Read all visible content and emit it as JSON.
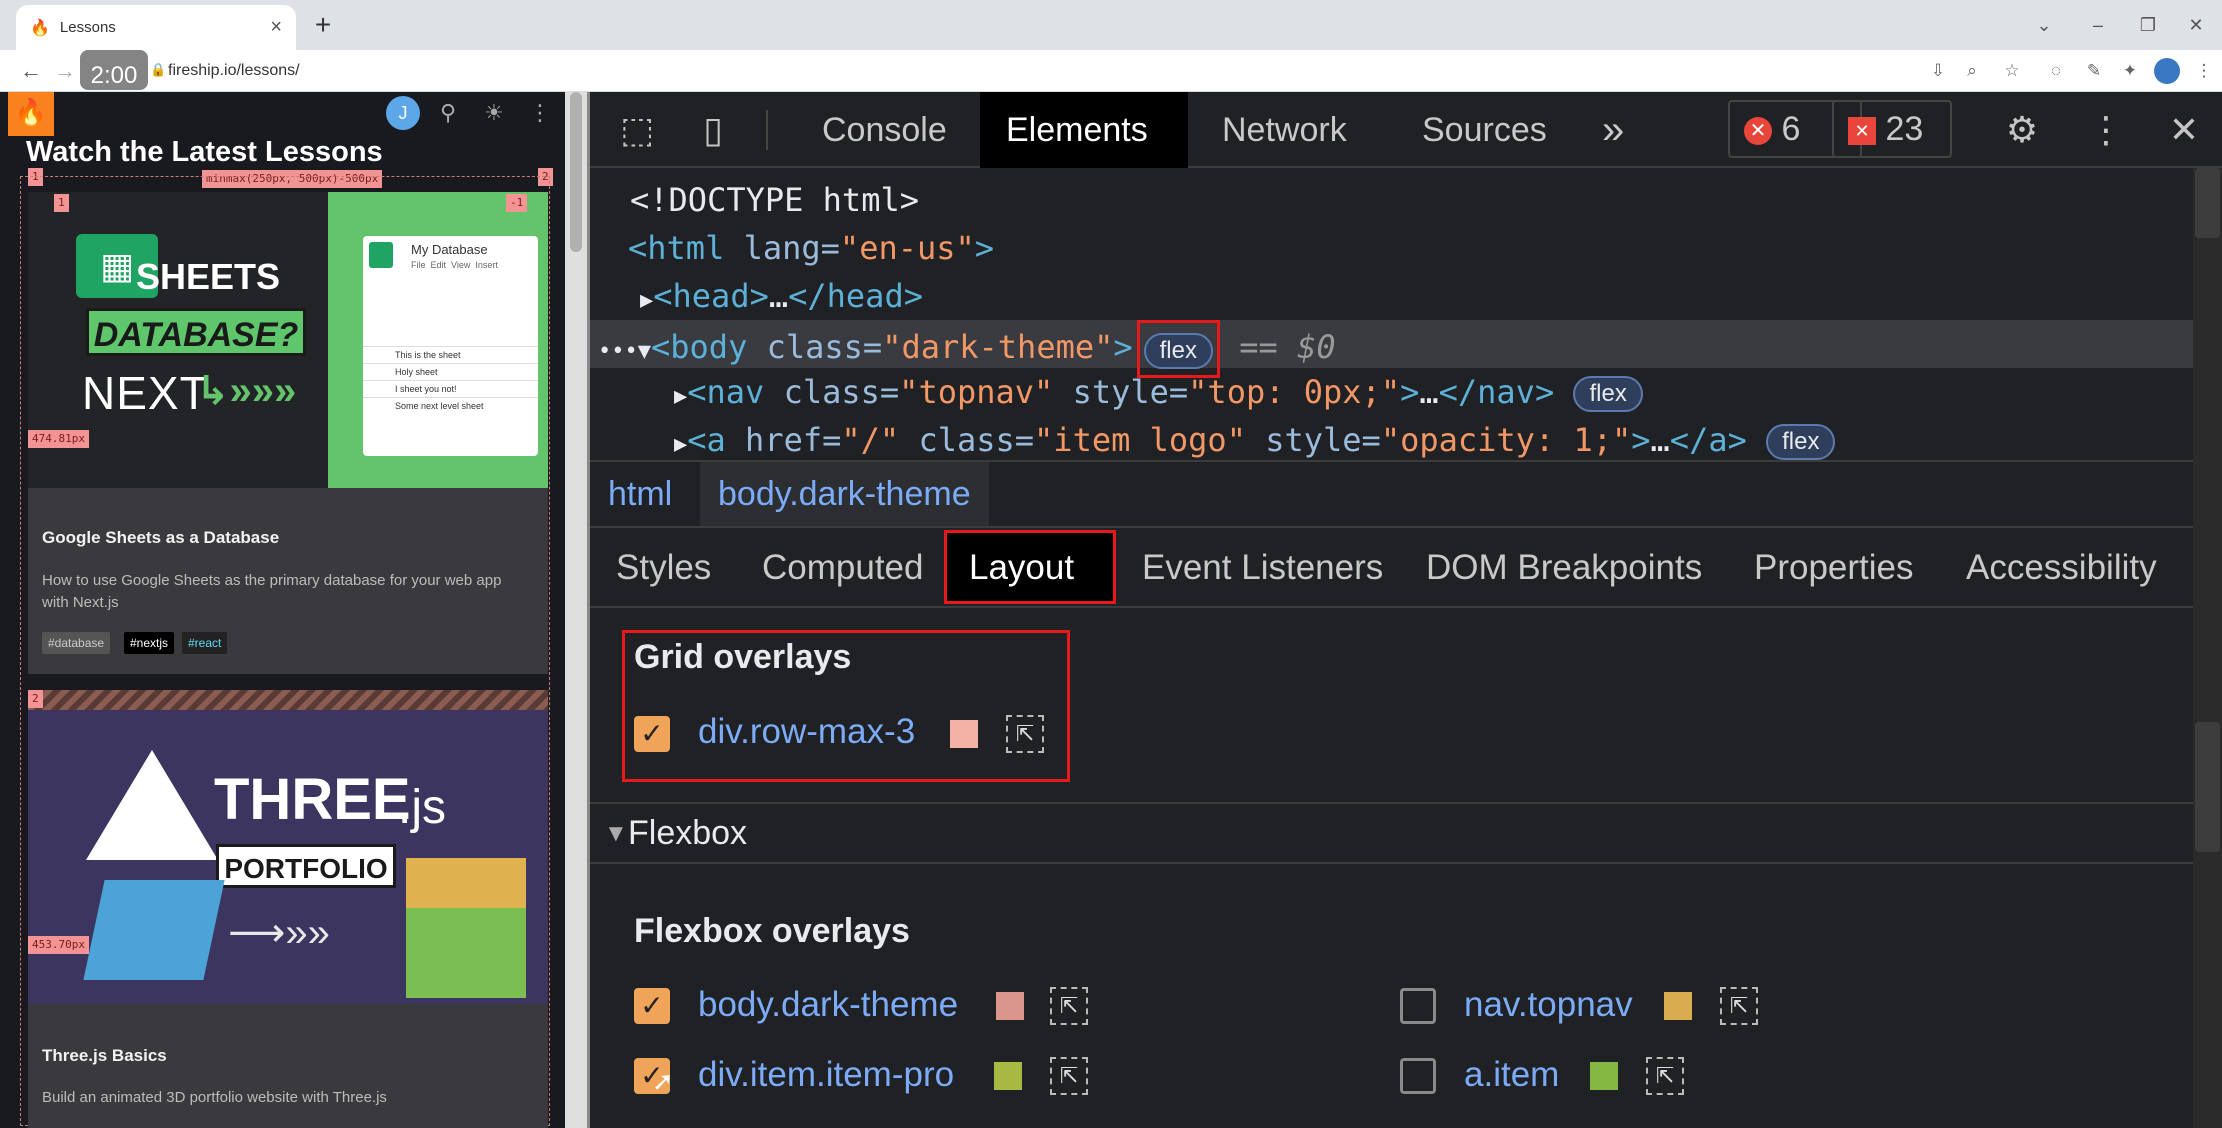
{
  "browser": {
    "tab_title": "Lessons",
    "tab_close": "×",
    "new_tab": "+",
    "url": "fireship.io/lessons/",
    "timer": "2:00",
    "window_controls": [
      "minimize-icon",
      "restore-icon",
      "close-icon"
    ]
  },
  "page": {
    "logo_text": "🔥",
    "avatar_text": "J",
    "heading": "Watch the Latest Lessons",
    "grid_badges": [
      "1",
      "minmax(250px, 500px)-500px",
      "2",
      "1",
      "-1",
      "474.81px",
      "2",
      "453.70px"
    ],
    "cards": [
      {
        "image_title_1": "SHEETS",
        "image_title_2": "DATABASE?",
        "image_title_3": "NEXT",
        "mini_sheet_title": "My Database",
        "mini_sheet_rows": [
          "This is the sheet",
          "Holy sheet",
          "I sheet you not!",
          "Some next level sheet"
        ],
        "mini_sheet_menu": "File  Edit  View  Insert",
        "title": "Google Sheets as a Database",
        "desc": "How to use Google Sheets as the primary database for your web app with Next.js",
        "tags": [
          "#database",
          "#nextjs",
          "#react"
        ]
      },
      {
        "image_title_1": "THREE",
        "image_title_2": ".js",
        "image_title_3": "PORTFOLIO",
        "title": "Three.js Basics",
        "desc": "Build an animated 3D portfolio website with Three.js"
      }
    ]
  },
  "devtools": {
    "tabs": [
      "Console",
      "Elements",
      "Network",
      "Sources"
    ],
    "active_tab": "Elements",
    "more": "»",
    "errors": "6",
    "warnings": "23",
    "dom_lines": [
      {
        "text": "<!DOCTYPE html>"
      },
      {
        "tag_open": "<html",
        "attr_name": " lang=",
        "attr_val": "\"en-us\"",
        "tag_close": ">"
      },
      {
        "tag": "<head>",
        "mid": "…",
        "end": "</head>"
      },
      {
        "tag_open": "<body",
        "attr_name": " class=",
        "attr_val": "\"dark-theme\"",
        "tag_close": ">",
        "pill": "flex",
        "suffix": " == $0"
      },
      {
        "tag_open": "<nav",
        "attr_name": " class=",
        "attr_val": "\"topnav\"",
        "attr_name2": " style=",
        "attr_val2": "\"top: 0px;\"",
        "tag_close": ">",
        "mid": "…",
        "end": "</nav>",
        "pill": "flex"
      },
      {
        "tag_open": "<a",
        "attr_name": " href=",
        "attr_val": "\"/\"",
        "attr_name2": " class=",
        "attr_val2": "\"item logo\"",
        "attr_name3": " style=",
        "attr_val3": "\"opacity: 1;\"",
        "tag_close": ">",
        "mid": "…",
        "end": "</a>",
        "pill": "flex"
      }
    ],
    "breadcrumbs": [
      "html",
      "body.dark-theme"
    ],
    "panel_tabs": [
      "Styles",
      "Computed",
      "Layout",
      "Event Listeners",
      "DOM Breakpoints",
      "Properties",
      "Accessibility"
    ],
    "active_panel_tab": "Layout",
    "grid_overlays": {
      "title": "Grid overlays",
      "items": [
        {
          "label": "div.row-max-3",
          "checked": true,
          "color": "#f2b1a3"
        }
      ]
    },
    "flexbox": {
      "section_title": "Flexbox",
      "overlays_title": "Flexbox overlays",
      "items": [
        {
          "label": "body.dark-theme",
          "checked": true,
          "color": "#d9958b"
        },
        {
          "label": "nav.topnav",
          "checked": false,
          "color": "#d9ac4f"
        },
        {
          "label": "div.item.item-pro",
          "checked": true,
          "color": "#a7b843"
        },
        {
          "label": "a.item",
          "checked": false,
          "color": "#84b843"
        }
      ]
    }
  }
}
